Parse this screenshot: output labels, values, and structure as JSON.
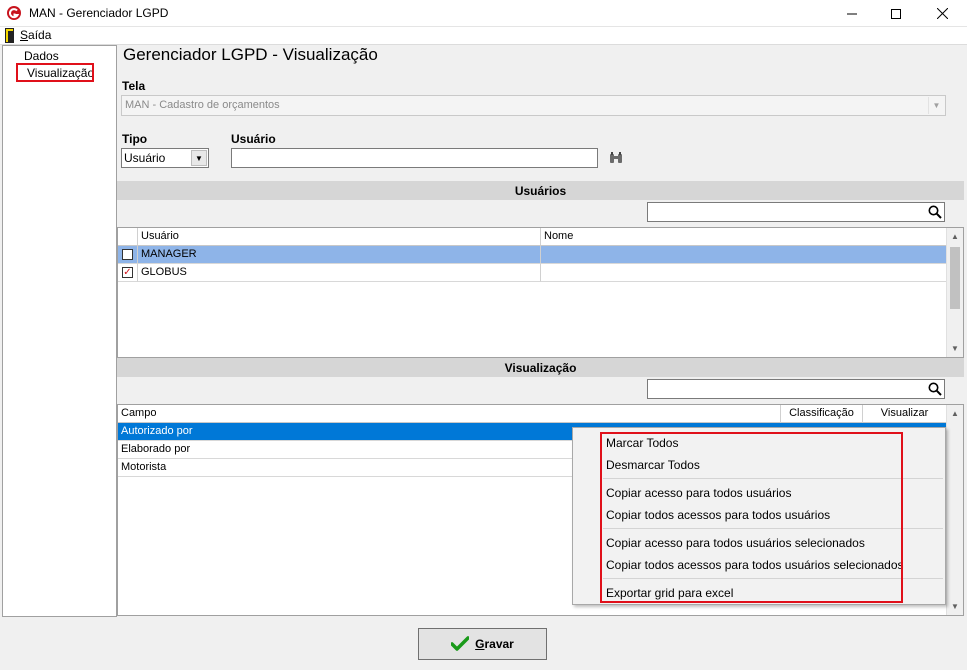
{
  "window": {
    "title": "MAN - Gerenciador LGPD",
    "minimize_glyph": "—",
    "maximize_glyph": "☐",
    "close_glyph": "✕"
  },
  "menu": {
    "exit_first": "S",
    "exit_rest": "aída"
  },
  "tree": {
    "items": [
      {
        "label": "Dados"
      },
      {
        "label": "Visualização"
      }
    ]
  },
  "page": {
    "title": "Gerenciador LGPD - Visualização"
  },
  "form": {
    "tela_label": "Tela",
    "tela_value": "MAN - Cadastro de orçamentos",
    "tipo_label": "Tipo",
    "tipo_value": "Usuário",
    "usuario_label": "Usuário",
    "usuario_value": ""
  },
  "usuarios_section": {
    "header": "Usuários",
    "search_value": "",
    "columns": [
      "Usuário",
      "Nome"
    ],
    "rows": [
      {
        "checked": false,
        "usuario": "MANAGER",
        "nome": "",
        "selected": true
      },
      {
        "checked": true,
        "usuario": "GLOBUS",
        "nome": "",
        "selected": false
      }
    ]
  },
  "visualizacao_section": {
    "header": "Visualização",
    "search_value": "",
    "columns": [
      "Campo",
      "Classificação",
      "Visualizar"
    ],
    "rows": [
      {
        "campo": "Autorizado por",
        "selected": true
      },
      {
        "campo": "Elaborado por",
        "selected": false
      },
      {
        "campo": "Motorista",
        "selected": false
      }
    ]
  },
  "context_menu": {
    "items": [
      "Marcar Todos",
      "Desmarcar Todos",
      "Copiar acesso para todos usuários",
      "Copiar todos acessos para todos usuários",
      "Copiar acesso para todos usuários selecionados",
      "Copiar todos acessos para todos usuários selecionados",
      "Exportar grid para excel"
    ]
  },
  "footer": {
    "save_first": "G",
    "save_rest": "ravar"
  },
  "colors": {
    "highlight_red": "#e0101a",
    "selection_blue": "#0078d7",
    "row_blue": "#8eb4e8",
    "check_red": "#d2121a",
    "save_green": "#1a9a1a"
  },
  "icons": [
    "app-icon",
    "exit-icon",
    "binoculars-icon",
    "search-icon",
    "checkmark-icon"
  ]
}
